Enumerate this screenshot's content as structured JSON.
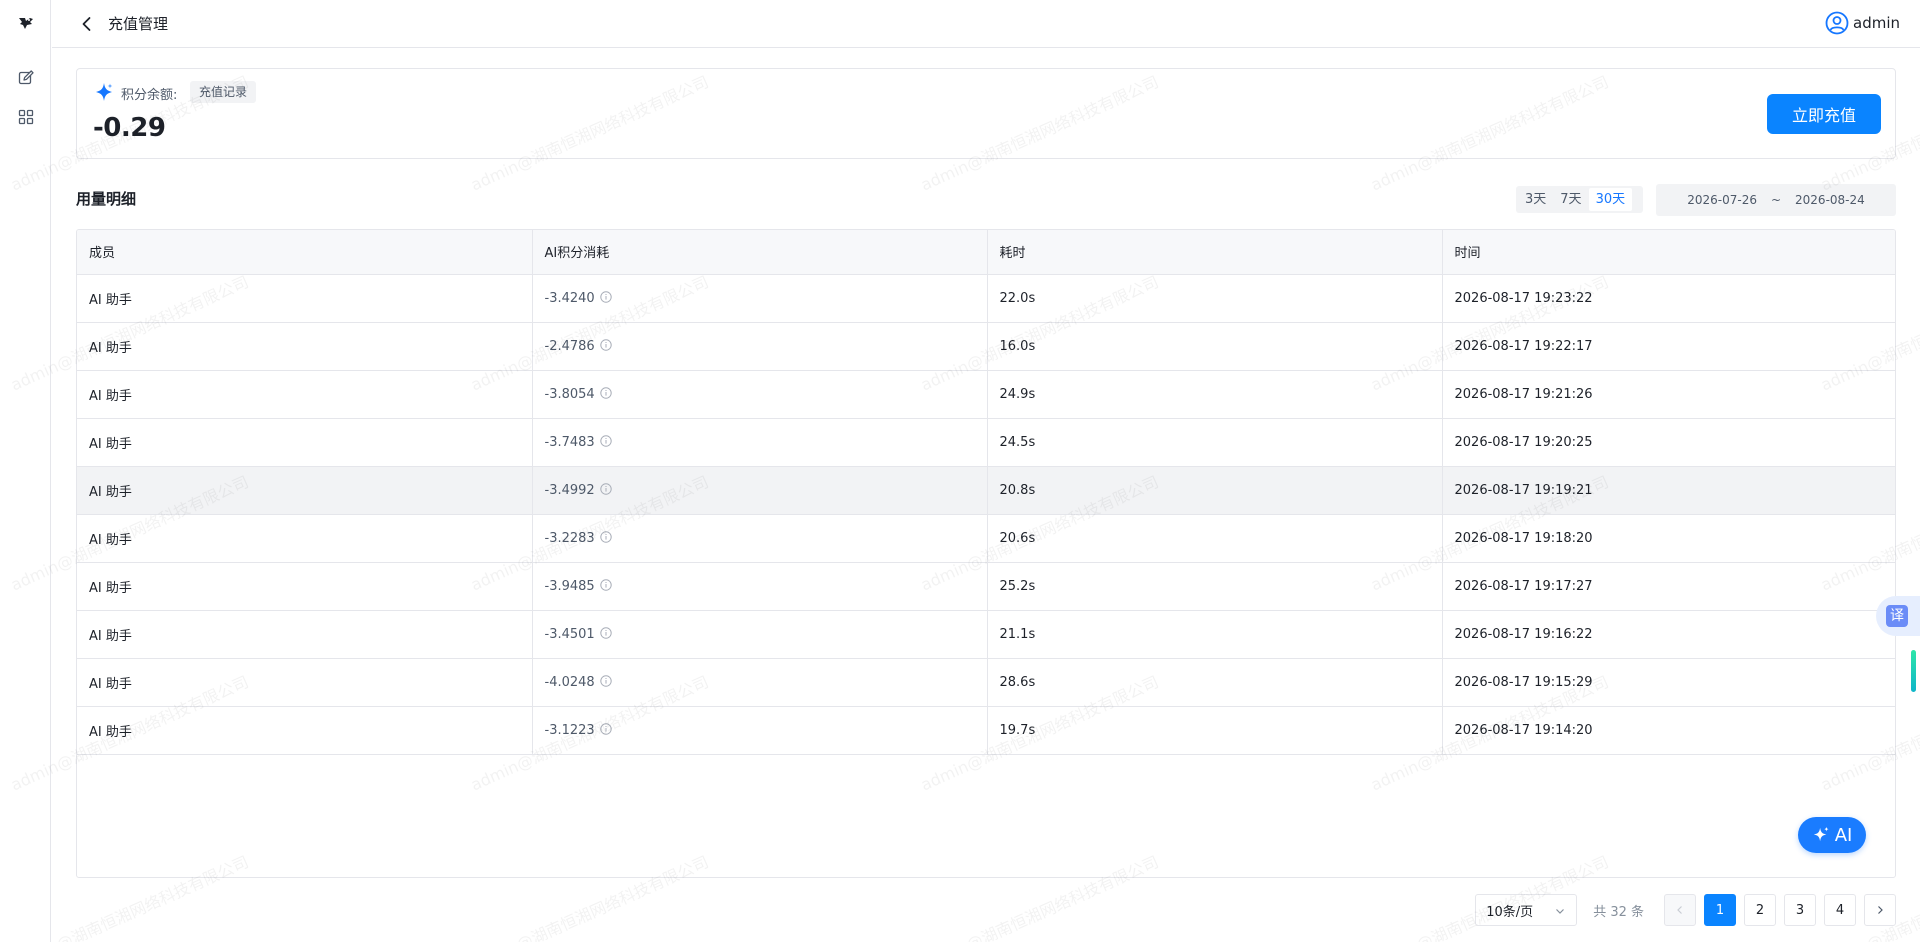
{
  "header": {
    "title": "充值管理",
    "user_name": "admin"
  },
  "balance": {
    "label": "积分余额:",
    "record_label": "充值记录",
    "value": "-0.29",
    "recharge_label": "立即充值"
  },
  "usage": {
    "title": "用量明细",
    "ranges": [
      "3天",
      "7天",
      "30天"
    ],
    "active_range": "30天",
    "date_start": "2026-07-26",
    "date_sep": "~",
    "date_end": "2026-08-24"
  },
  "table": {
    "columns": [
      "成员",
      "AI积分消耗",
      "耗时",
      "时间"
    ],
    "rows": [
      {
        "member": "AI 助手",
        "cost": "-3.4240",
        "duration": "22.0s",
        "time": "2026-08-17 19:23:22"
      },
      {
        "member": "AI 助手",
        "cost": "-2.4786",
        "duration": "16.0s",
        "time": "2026-08-17 19:22:17"
      },
      {
        "member": "AI 助手",
        "cost": "-3.8054",
        "duration": "24.9s",
        "time": "2026-08-17 19:21:26"
      },
      {
        "member": "AI 助手",
        "cost": "-3.7483",
        "duration": "24.5s",
        "time": "2026-08-17 19:20:25"
      },
      {
        "member": "AI 助手",
        "cost": "-3.4992",
        "duration": "20.8s",
        "time": "2026-08-17 19:19:21"
      },
      {
        "member": "AI 助手",
        "cost": "-3.2283",
        "duration": "20.6s",
        "time": "2026-08-17 19:18:20"
      },
      {
        "member": "AI 助手",
        "cost": "-3.9485",
        "duration": "25.2s",
        "time": "2026-08-17 19:17:27"
      },
      {
        "member": "AI 助手",
        "cost": "-3.4501",
        "duration": "21.1s",
        "time": "2026-08-17 19:16:22"
      },
      {
        "member": "AI 助手",
        "cost": "-4.0248",
        "duration": "28.6s",
        "time": "2026-08-17 19:15:29"
      },
      {
        "member": "AI 助手",
        "cost": "-3.1223",
        "duration": "19.7s",
        "time": "2026-08-17 19:14:20"
      }
    ]
  },
  "pagination": {
    "page_size": "10条/页",
    "total": "共 32 条",
    "pages": [
      "1",
      "2",
      "3",
      "4"
    ],
    "current": "1"
  },
  "floating": {
    "translate_label": "译",
    "ai_label": "AI"
  },
  "watermark": {
    "text": "admin@湖南恒湘网络科技有限公司"
  },
  "colors": {
    "primary": "#0a84ff",
    "border": "#e5e6eb",
    "header_bg": "#f7f8fa",
    "text": "#1d2129",
    "muted": "#4e5969"
  },
  "icons": {
    "logo": "bird-logo-icon",
    "edit": "edit-icon",
    "apps": "grid-icon",
    "back": "chevron-left-icon",
    "user": "user-circle-icon",
    "sparkle": "sparkle-icon",
    "info": "info-circle-icon"
  }
}
